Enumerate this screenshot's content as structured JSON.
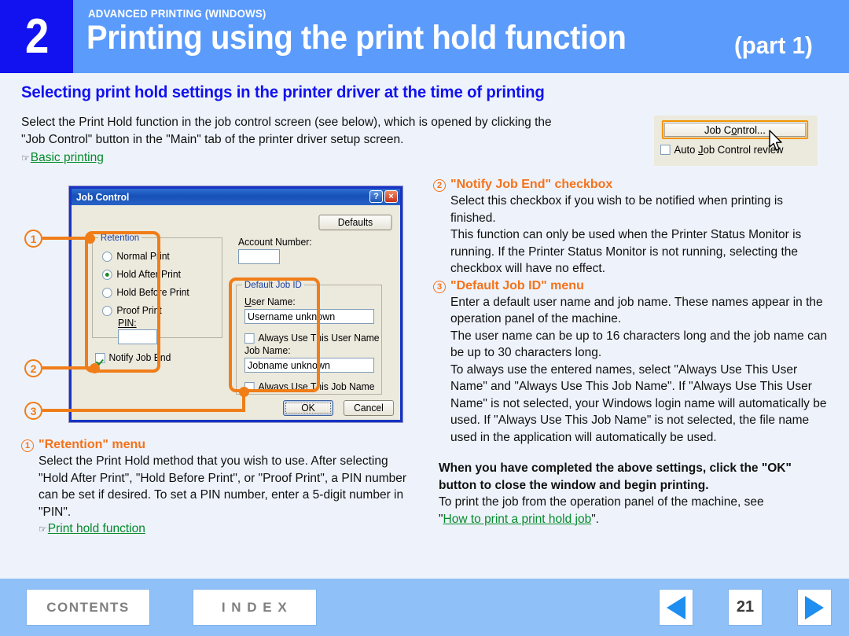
{
  "header": {
    "chapter_number": "2",
    "kicker": "ADVANCED PRINTING (WINDOWS)",
    "title": "Printing using the print hold function",
    "part": "(part 1)"
  },
  "section_heading": "Selecting print hold settings in the printer driver at the time of printing",
  "intro": {
    "line1": "Select the Print Hold function in the job control screen (see below), which is opened by clicking the",
    "line2": "\"Job Control\" button in the \"Main\" tab of the printer driver setup screen.",
    "link_icon": "☞",
    "link": "Basic printing"
  },
  "job_control_cluster": {
    "button_label_pre": "Job C",
    "button_label_underline": "o",
    "button_label_post": "ntrol...",
    "button_label": "Job Control...",
    "checkbox_label_pre": "Auto ",
    "checkbox_label_underline": "J",
    "checkbox_label_post": "ob Control review",
    "checkbox_label": "Auto Job Control review",
    "checkbox_checked": false,
    "cursor": "arrow-cursor"
  },
  "dialog": {
    "title": "Job Control",
    "help_button": "?",
    "close_button": "×",
    "defaults_button": "Defaults",
    "ok_button": "OK",
    "cancel_button": "Cancel",
    "retention": {
      "group_label": "Retention",
      "options": [
        {
          "label": "Normal Print",
          "selected": false
        },
        {
          "label": "Hold After Print",
          "selected": true
        },
        {
          "label": "Hold Before Print",
          "selected": false
        },
        {
          "label": "Proof Print",
          "selected": false
        }
      ],
      "pin_label": "PIN:",
      "pin_value": ""
    },
    "notify_job_end": {
      "label": "Notify Job End",
      "checked": true
    },
    "account_number": {
      "label": "Account Number:",
      "value": ""
    },
    "default_job_id": {
      "group_label": "Default Job ID",
      "user_name_label": "User Name:",
      "user_name_value": "Username unknown",
      "always_user_label": "Always Use This User Name",
      "always_user_checked": false,
      "job_name_label": "Job Name:",
      "job_name_value": "Jobname unknown",
      "always_job_label": "Always Use This Job Name",
      "always_job_checked": false
    }
  },
  "callouts": {
    "one": "1",
    "two": "2",
    "three": "3"
  },
  "notes": {
    "note1": {
      "number": "1",
      "heading": "\"Retention\" menu",
      "body": "Select the Print Hold method that you wish to use. After selecting \"Hold After Print\", \"Hold Before Print\", or \"Proof Print\", a PIN number can be set if desired. To set a PIN number, enter a 5-digit number in \"PIN\".",
      "link_icon": "☞",
      "link": "Print hold function"
    },
    "note2": {
      "number": "2",
      "heading": "\"Notify Job End\" checkbox",
      "body": "Select this checkbox if you wish to be notified when printing is finished.\nThis function can only be used when the Printer Status Monitor is running. If the Printer Status Monitor is not running, selecting the checkbox will have no effect."
    },
    "note3": {
      "number": "3",
      "heading": "\"Default Job ID\" menu",
      "body": "Enter a default user name and job name. These names appear in the operation panel of the machine.\nThe user name can be up to 16 characters long and the job name can be up to 30 characters long.\nTo always use the entered names, select \"Always Use This User Name\" and \"Always Use This Job Name\". If \"Always Use This User Name\" is not selected, your Windows login name will automatically be used. If \"Always Use This Job Name\" is not selected, the file name used in the application will automatically be used."
    },
    "closing_bold": "When you have completed the above settings, click the \"OK\" button to close the window and begin printing.",
    "closing_plain_pre": "To print the job from the operation panel of the machine, see",
    "closing_quote_open": "\"",
    "closing_link": "How to print a print hold job",
    "closing_quote_close": "\"."
  },
  "footer": {
    "contents": "CONTENTS",
    "index": "I N D E X",
    "page_number": "21",
    "prev_icon": "previous-page-arrow",
    "next_icon": "next-page-arrow"
  },
  "colors": {
    "header_blue": "#5b9bfb",
    "chapter_blue": "#1212f0",
    "heading_blue": "#1212f0",
    "callout_orange": "#f07d18",
    "link_green": "#048a2a",
    "footer_blue": "#8fc0f7",
    "dialog_face": "#ece9dd"
  }
}
